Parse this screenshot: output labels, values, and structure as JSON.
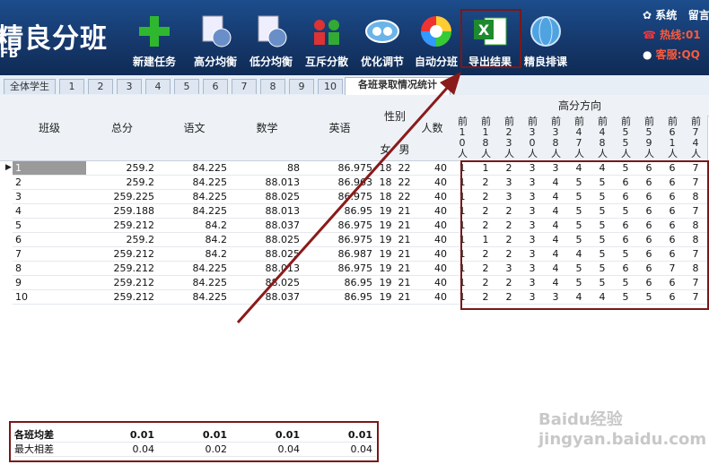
{
  "app": {
    "title": "精良分班",
    "subtitle": "FB"
  },
  "toolbar": [
    {
      "label": "新建任务",
      "icon": "plus-icon"
    },
    {
      "label": "高分均衡",
      "icon": "doc-clock-icon"
    },
    {
      "label": "低分均衡",
      "icon": "doc-clock-icon"
    },
    {
      "label": "互斥分散",
      "icon": "people-icon"
    },
    {
      "label": "优化调节",
      "icon": "arrows-icon"
    },
    {
      "label": "自动分班",
      "icon": "color-wheel-icon"
    },
    {
      "label": "导出结果",
      "icon": "excel-icon"
    },
    {
      "label": "精良排课",
      "icon": "globe-icon"
    }
  ],
  "right_info": {
    "system": "系统",
    "leave": "留言",
    "hotline": "热线:",
    "hotline_val": "01",
    "support": "客服:",
    "support_val": "QQ"
  },
  "tabs": [
    "全体学生",
    "1",
    "2",
    "3",
    "4",
    "5",
    "6",
    "7",
    "8",
    "9",
    "10",
    "各班录取情况统计"
  ],
  "headers": {
    "class": "班级",
    "total": "总分",
    "chinese": "语文",
    "math": "数学",
    "english": "英语",
    "gender": "性别",
    "female": "女",
    "male": "男",
    "count": "人数",
    "high_dir": "高分方向"
  },
  "rank_headers": [
    "前10人",
    "前18人",
    "前23人",
    "前30人",
    "前38人",
    "前47人",
    "前48人",
    "前55人",
    "前59人",
    "前61人",
    "前74人"
  ],
  "rows": [
    {
      "cls": "1",
      "total": "259.2",
      "ch": "84.225",
      "ma": "88",
      "en": "86.975",
      "f": "18",
      "m": "22",
      "n": "40",
      "ranks": [
        "1",
        "1",
        "2",
        "3",
        "3",
        "4",
        "4",
        "5",
        "6",
        "6",
        "7"
      ]
    },
    {
      "cls": "2",
      "total": "259.2",
      "ch": "84.225",
      "ma": "88.013",
      "en": "86.963",
      "f": "18",
      "m": "22",
      "n": "40",
      "ranks": [
        "1",
        "2",
        "3",
        "3",
        "4",
        "5",
        "5",
        "6",
        "6",
        "6",
        "7"
      ]
    },
    {
      "cls": "3",
      "total": "259.225",
      "ch": "84.225",
      "ma": "88.025",
      "en": "86.975",
      "f": "18",
      "m": "22",
      "n": "40",
      "ranks": [
        "1",
        "2",
        "3",
        "3",
        "4",
        "5",
        "5",
        "6",
        "6",
        "6",
        "8"
      ]
    },
    {
      "cls": "4",
      "total": "259.188",
      "ch": "84.225",
      "ma": "88.013",
      "en": "86.95",
      "f": "19",
      "m": "21",
      "n": "40",
      "ranks": [
        "1",
        "2",
        "2",
        "3",
        "4",
        "5",
        "5",
        "5",
        "6",
        "6",
        "7"
      ]
    },
    {
      "cls": "5",
      "total": "259.212",
      "ch": "84.2",
      "ma": "88.037",
      "en": "86.975",
      "f": "19",
      "m": "21",
      "n": "40",
      "ranks": [
        "1",
        "2",
        "2",
        "3",
        "4",
        "5",
        "5",
        "6",
        "6",
        "6",
        "8"
      ]
    },
    {
      "cls": "6",
      "total": "259.2",
      "ch": "84.2",
      "ma": "88.025",
      "en": "86.975",
      "f": "19",
      "m": "21",
      "n": "40",
      "ranks": [
        "1",
        "1",
        "2",
        "3",
        "4",
        "5",
        "5",
        "6",
        "6",
        "6",
        "8"
      ]
    },
    {
      "cls": "7",
      "total": "259.212",
      "ch": "84.2",
      "ma": "88.025",
      "en": "86.987",
      "f": "19",
      "m": "21",
      "n": "40",
      "ranks": [
        "1",
        "2",
        "2",
        "3",
        "4",
        "4",
        "5",
        "5",
        "6",
        "6",
        "7"
      ]
    },
    {
      "cls": "8",
      "total": "259.212",
      "ch": "84.225",
      "ma": "88.013",
      "en": "86.975",
      "f": "19",
      "m": "21",
      "n": "40",
      "ranks": [
        "1",
        "2",
        "3",
        "3",
        "4",
        "5",
        "5",
        "6",
        "6",
        "7",
        "8"
      ]
    },
    {
      "cls": "9",
      "total": "259.212",
      "ch": "84.225",
      "ma": "88.025",
      "en": "86.95",
      "f": "19",
      "m": "21",
      "n": "40",
      "ranks": [
        "1",
        "2",
        "2",
        "3",
        "4",
        "5",
        "5",
        "5",
        "6",
        "6",
        "7"
      ]
    },
    {
      "cls": "10",
      "total": "259.212",
      "ch": "84.225",
      "ma": "88.037",
      "en": "86.95",
      "f": "19",
      "m": "21",
      "n": "40",
      "ranks": [
        "1",
        "2",
        "2",
        "3",
        "3",
        "4",
        "4",
        "5",
        "5",
        "6",
        "7"
      ]
    }
  ],
  "footer": {
    "avg_label": "各班均差",
    "avg": [
      "0.01",
      "0.01",
      "0.01",
      "0.01"
    ],
    "max_label": "最大相差",
    "max": [
      "0.04",
      "0.02",
      "0.04",
      "0.04"
    ]
  },
  "watermark": "Baidu经验 jingyan.baidu.com",
  "colors": {
    "toolbar": "#1c4d8c",
    "highlight": "#7a1818",
    "arrow": "#8b1a1a"
  }
}
